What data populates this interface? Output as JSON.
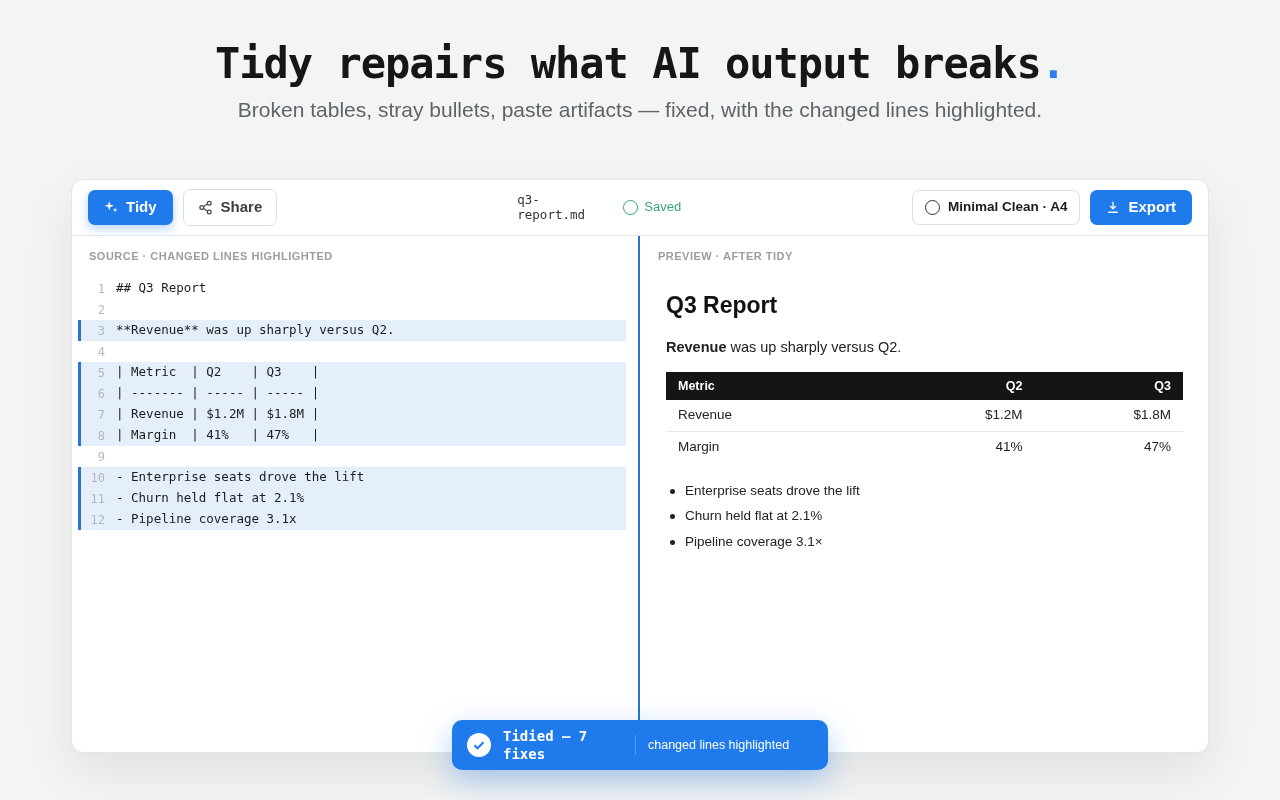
{
  "hero": {
    "title": "Tidy repairs what AI output breaks",
    "title_accent": ".",
    "subtitle": "Broken tables, stray bullets, paste artifacts — fixed, with the changed lines highlighted."
  },
  "toolbar": {
    "tidy_button": "Tidy",
    "share_button": "Share",
    "filename": "q3-report.md",
    "status": "Saved",
    "theme_selector": "Minimal Clean · A4",
    "export_button": "Export"
  },
  "source": {
    "heading": "SOURCE · CHANGED LINES HIGHLIGHTED",
    "lines": [
      {
        "number": "1",
        "text": "## Q3 Report",
        "changed": false
      },
      {
        "number": "2",
        "changed": false
      },
      {
        "number": "3",
        "text": "**Revenue** was up sharply versus Q2.",
        "changed": true
      },
      {
        "number": "4",
        "changed": false
      },
      {
        "number": "5",
        "text": "| Metric  | Q2    | Q3    |",
        "changed": true
      },
      {
        "number": "6",
        "text": "| ------- | ----- | ----- |",
        "changed": true
      },
      {
        "number": "7",
        "text": "| Revenue | $1.2M | $1.8M |",
        "changed": true
      },
      {
        "number": "8",
        "text": "| Margin  | 41%   | 47%   |",
        "changed": true
      },
      {
        "number": "9",
        "changed": false
      },
      {
        "number": "10",
        "text": "- Enterprise seats drove the lift",
        "changed": true
      },
      {
        "number": "11",
        "text": "- Churn held flat at 2.1%",
        "changed": true
      },
      {
        "number": "12",
        "text": "- Pipeline coverage 3.1x",
        "changed": true
      }
    ]
  },
  "preview": {
    "heading": "PREVIEW · AFTER TIDY",
    "title": "Q3 Report",
    "paragraph": "**Revenue** was up sharply versus Q2.",
    "table": {
      "columns": [
        "Metric",
        "Q2",
        "Q3"
      ],
      "rows": [
        [
          "Revenue",
          "$1.2M",
          "$1.8M"
        ],
        [
          "Margin",
          "41%",
          "47%"
        ]
      ]
    },
    "bullets": [
      "Enterprise seats drove the lift",
      "Churn held flat at 2.1%",
      "Pipeline coverage 3.1×"
    ]
  },
  "toast": {
    "title": "Tidied — 7 fixes",
    "note": "changed lines highlighted"
  }
}
